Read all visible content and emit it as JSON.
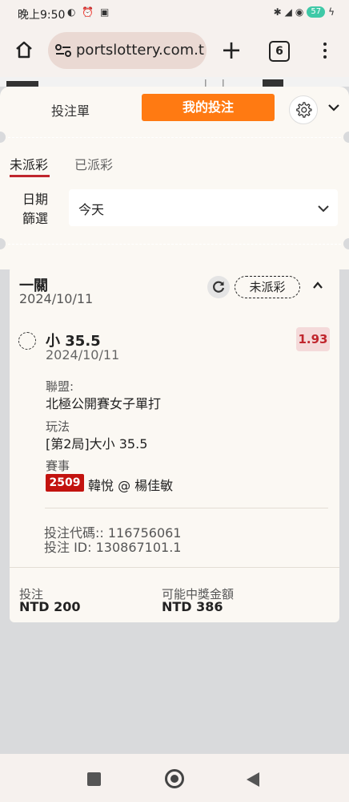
{
  "status_bar": {
    "time": "晚上9:50",
    "battery": "57"
  },
  "browser": {
    "url": "portslottery.com.tw",
    "tab_count": "6"
  },
  "panel": {
    "tab_betslip": "投注單",
    "tab_mybets": "我的投注",
    "sub_tabs": {
      "unsettled": "未派彩",
      "settled": "已派彩"
    },
    "date_filter": {
      "label_line1": "日期",
      "label_line2": "篩選",
      "value": "今天"
    }
  },
  "bet": {
    "title": "一關",
    "date": "2024/10/11",
    "status": "未派彩",
    "selection": {
      "name": "小 35.5",
      "date": "2024/10/11",
      "odds": "1.93",
      "league_label": "聯盟:",
      "league": "北極公開賽女子單打",
      "play_label": "玩法",
      "play": "[第2局]大小 35.5",
      "event_label": "賽事",
      "event_code": "2509",
      "event_teams": "韓悅 @ 楊佳敏"
    },
    "bet_code": "投注代碼:: 116756061",
    "bet_id": "投注 ID: 130867101.1",
    "stake_label": "投注",
    "stake_value": "NTD 200",
    "payout_label": "可能中獎金額",
    "payout_value": "NTD 386"
  },
  "colors": {
    "accent": "#ff7a12",
    "underline": "#c0262d",
    "event_badge": "#c3130f"
  }
}
